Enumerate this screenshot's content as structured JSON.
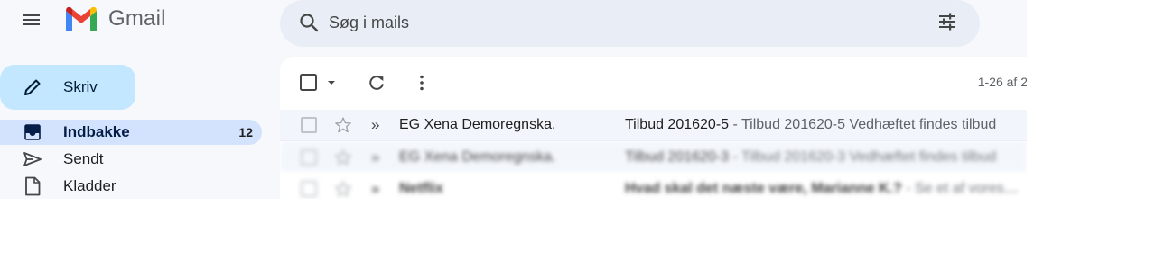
{
  "header": {
    "app_name": "Gmail",
    "search_placeholder": "Søg i mails"
  },
  "sidebar": {
    "compose_label": "Skriv",
    "items": [
      {
        "label": "Indbakke",
        "count": "12",
        "icon": "inbox-icon",
        "active": true
      },
      {
        "label": "Sendt",
        "count": "",
        "icon": "send-icon",
        "active": false
      },
      {
        "label": "Kladder",
        "count": "",
        "icon": "draft-icon",
        "active": false
      }
    ]
  },
  "toolbar": {
    "pager_text": "1-26 af 2"
  },
  "emails": [
    {
      "sender": "EG Xena Demoregnska.",
      "subject": "Tilbud 201620-5",
      "snippet": " - Tilbud 201620-5 Vedhæftet findes tilbud"
    },
    {
      "sender": "EG Xena Demoregnska.",
      "subject": "Tilbud 201620-3",
      "snippet": " - Tilbud 201620-3 Vedhæftet findes tilbud"
    },
    {
      "sender": "Netflix",
      "subject": "Hvad skal det næste være, Marianne K.?",
      "snippet": " - Se et af vores forslag"
    }
  ],
  "colors": {
    "background": "#f6f8fc",
    "compose": "#c2e7ff",
    "active_nav": "#d3e3fd",
    "search_bar": "#e9eef6"
  }
}
